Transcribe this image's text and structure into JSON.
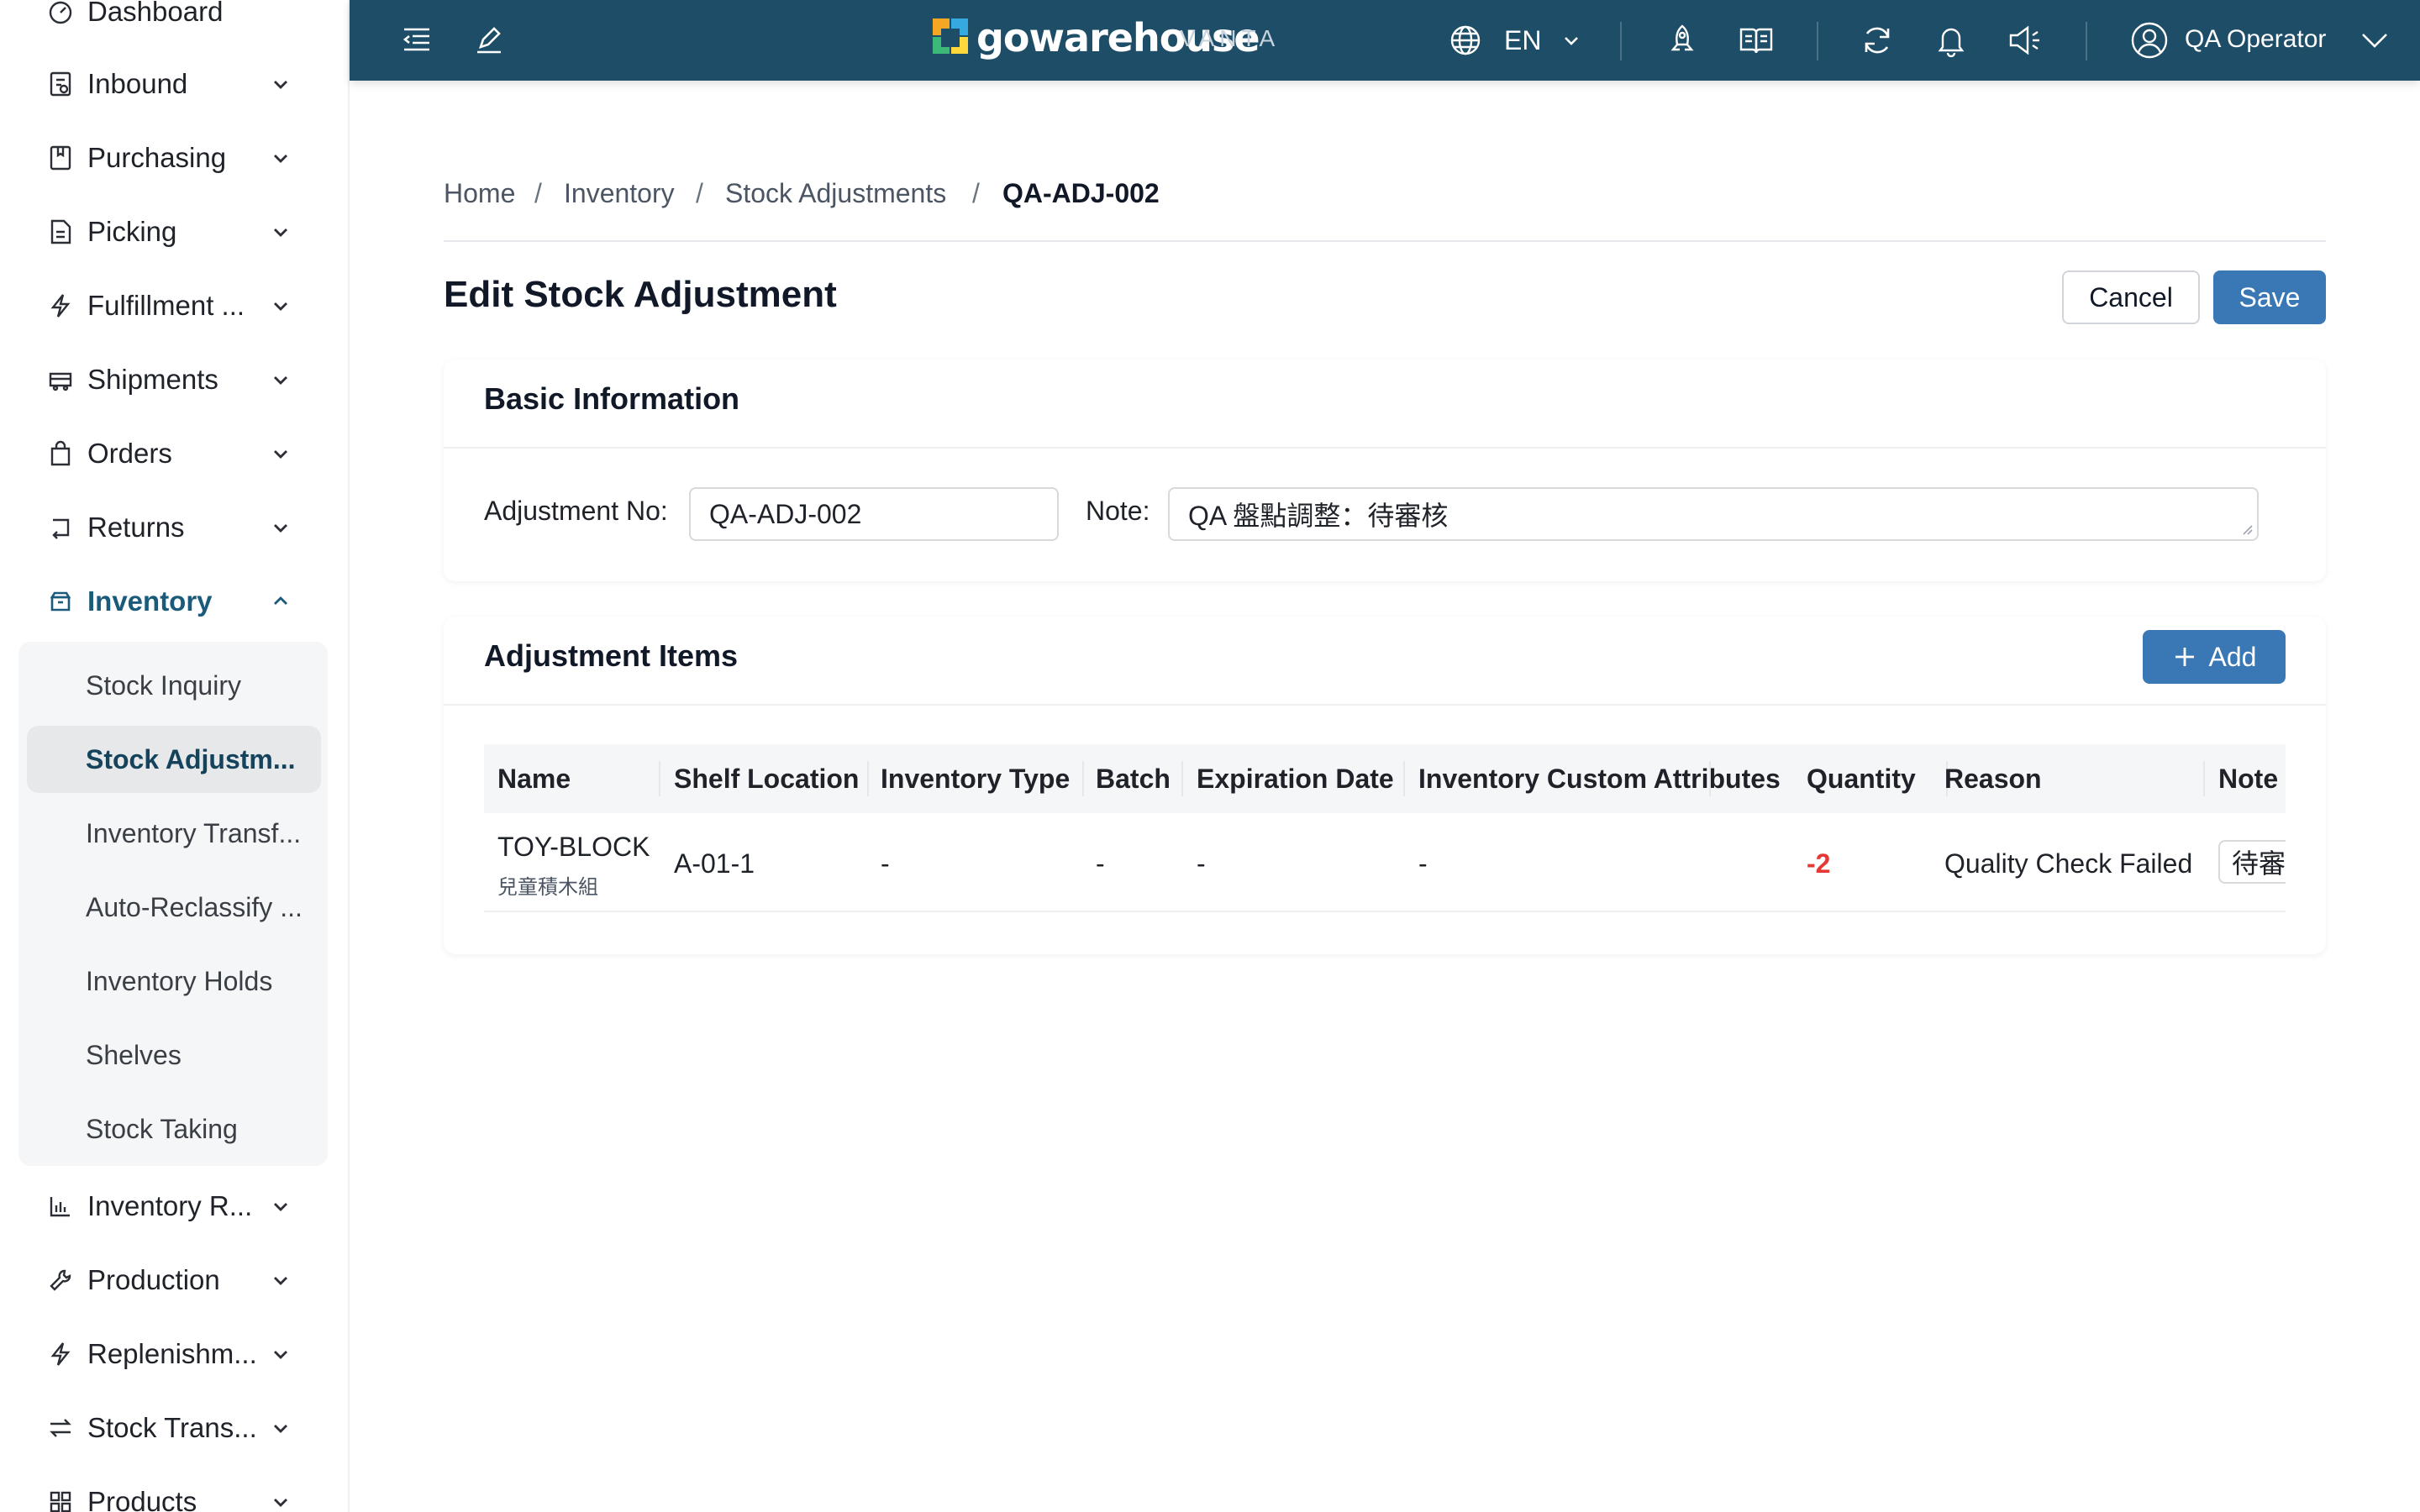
{
  "sidebar": {
    "items": [
      {
        "label": "Dashboard",
        "icon": "dashboard-icon"
      },
      {
        "label": "Inbound",
        "icon": "inbound-icon"
      },
      {
        "label": "Purchasing",
        "icon": "purchasing-icon"
      },
      {
        "label": "Picking",
        "icon": "picking-icon"
      },
      {
        "label": "Fulfillment ...",
        "icon": "fulfillment-icon"
      },
      {
        "label": "Shipments",
        "icon": "shipments-icon"
      },
      {
        "label": "Orders",
        "icon": "orders-icon"
      },
      {
        "label": "Returns",
        "icon": "returns-icon"
      },
      {
        "label": "Inventory",
        "icon": "inventory-icon"
      },
      {
        "label": "Inventory R...",
        "icon": "inventory-reports-icon"
      },
      {
        "label": "Production",
        "icon": "production-icon"
      },
      {
        "label": "Replenishm...",
        "icon": "replenishment-icon"
      },
      {
        "label": "Stock Trans...",
        "icon": "stock-transfer-icon"
      },
      {
        "label": "Products",
        "icon": "products-icon"
      }
    ],
    "inventory_subitems": [
      "Stock Inquiry",
      "Stock Adjustm...",
      "Inventory Transf...",
      "Auto-Reclassify ...",
      "Inventory Holds",
      "Shelves",
      "Stock Taking"
    ]
  },
  "topbar": {
    "logo_text": "gowarehouse",
    "logo_sub": "VANTA",
    "language": "EN",
    "user": "QA Operator",
    "icons": [
      "menu-fold-icon",
      "edit-icon",
      "globe-icon",
      "rocket-icon",
      "book-icon",
      "refresh-icon",
      "bell-icon",
      "speaker-icon",
      "user-avatar-icon"
    ]
  },
  "breadcrumb": [
    "Home",
    "Inventory",
    "Stock Adjustments",
    "QA-ADJ-002"
  ],
  "page": {
    "title": "Edit Stock Adjustment",
    "cancel_label": "Cancel",
    "save_label": "Save"
  },
  "basic_info": {
    "title": "Basic Information",
    "adjustment_no_label": "Adjustment No",
    "adjustment_no_value": "QA-ADJ-002",
    "note_label": "Note",
    "note_value": "QA 盤點調整：待審核"
  },
  "items": {
    "title": "Adjustment Items",
    "add_label": "Add",
    "columns": [
      "Name",
      "Shelf Location",
      "Inventory Type",
      "Batch",
      "Expiration Date",
      "Inventory Custom Attributes",
      "Quantity",
      "Reason",
      "Note"
    ],
    "rows": [
      {
        "name": "TOY-BLOCK",
        "name_sub": "兒童積木組",
        "shelf_location": "A-01-1",
        "inventory_type": "-",
        "batch": "-",
        "expiration_date": "-",
        "custom_attributes": "-",
        "quantity": "-2",
        "reason": "Quality Check Failed",
        "note": "待審"
      }
    ],
    "quantity_negative_color": "#e53935"
  },
  "colors": {
    "topbar": "#1e4d68",
    "primary": "#3a77b5",
    "active_text": "#1a5a7a"
  }
}
